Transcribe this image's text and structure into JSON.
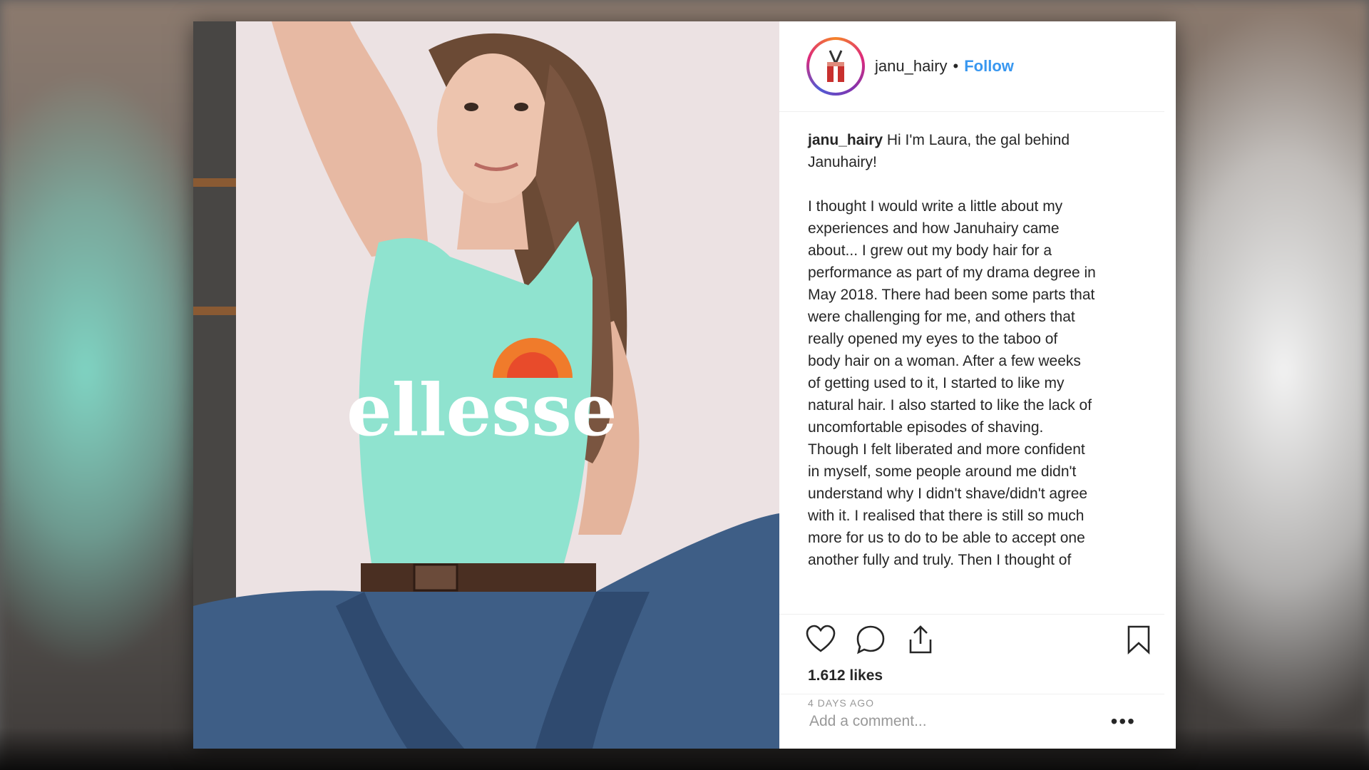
{
  "post": {
    "username": "janu_hairy",
    "separator": "•",
    "follow_label": "Follow",
    "caption_username": "janu_hairy",
    "caption_text": " Hi I'm Laura, the gal behind\nJanuhairy!\n\nI thought I would write a little about my\nexperiences and how Januhairy came\nabout... I grew out my body hair for a\nperformance as part of my drama degree in\nMay 2018. There had been some parts that\nwere challenging for me, and others that\nreally opened my eyes to the taboo of\nbody hair on a woman. After a few weeks\nof getting used to it, I started to like my\nnatural hair. I also started to like the lack of\nuncomfortable episodes of shaving.\nThough I felt liberated and more confident\nin myself, some people around me didn't\nunderstand why I didn't shave/didn't agree\nwith it. I realised that there is still so much\nmore for us to do to be able to accept one\nanother fully and truly. Then I thought of",
    "likes": "1.612 likes",
    "time_ago": "4 DAYS AGO",
    "comment_placeholder": "Add a comment...",
    "more_label": "•••",
    "shirt_logo_text": "ellesse"
  },
  "icons": {
    "like": "heart-icon",
    "comment": "comment-bubble-icon",
    "share": "share-upload-icon",
    "save": "bookmark-icon",
    "avatar": "avatar-logo"
  },
  "colors": {
    "link_blue": "#3897f0",
    "text": "#262626",
    "muted": "#999999",
    "shirt": "#8fe3cf",
    "denim": "#3e5e86"
  }
}
